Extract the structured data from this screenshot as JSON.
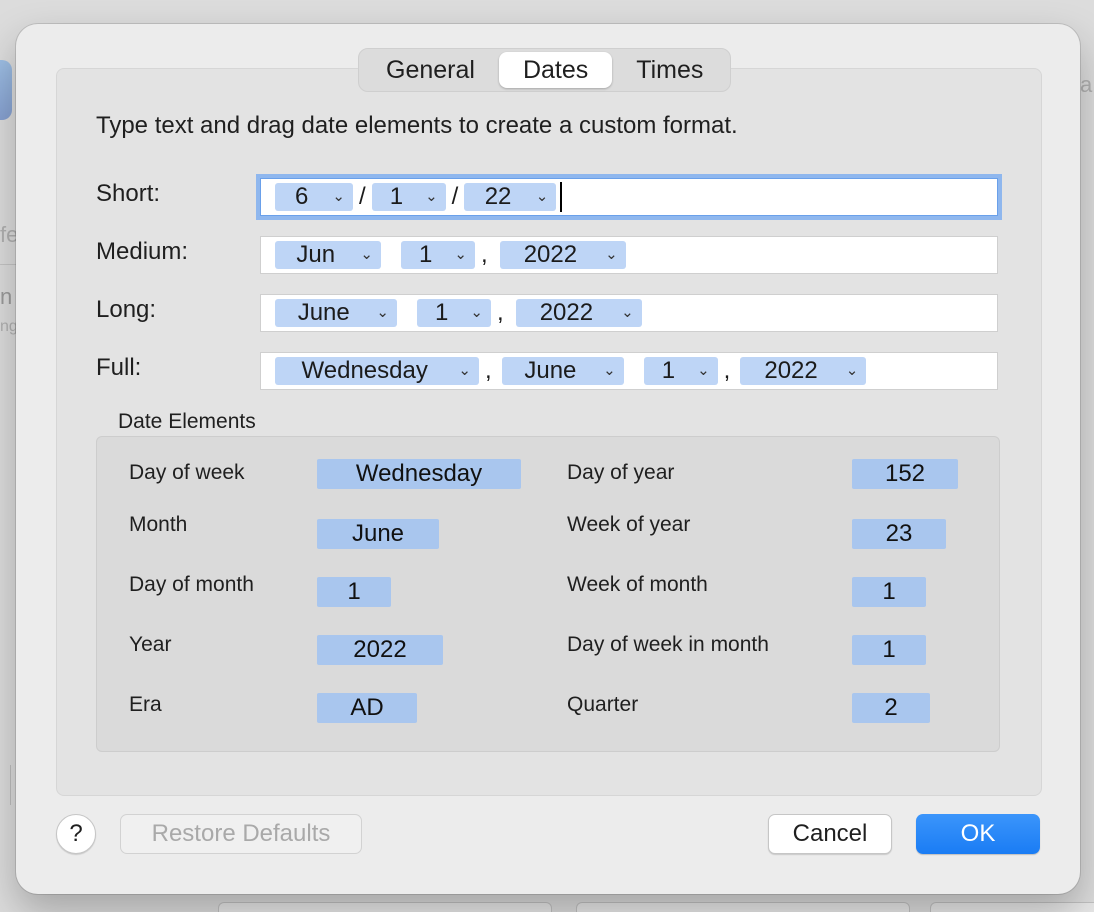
{
  "tabs": [
    {
      "label": "General",
      "selected": false
    },
    {
      "label": "Dates",
      "selected": true
    },
    {
      "label": "Times",
      "selected": false
    }
  ],
  "instructions": "Type text and drag date elements to create a custom format.",
  "formats": {
    "short": {
      "label": "Short:",
      "tokens": [
        "6",
        "1",
        "22"
      ],
      "separators": [
        "/",
        "/"
      ]
    },
    "medium": {
      "label": "Medium:",
      "tokens": [
        "Jun",
        "1",
        "2022"
      ],
      "separators": [
        ",",
        ""
      ]
    },
    "long": {
      "label": "Long:",
      "tokens": [
        "June",
        "1",
        "2022"
      ],
      "separators": [
        ",",
        ""
      ]
    },
    "full": {
      "label": "Full:",
      "tokens": [
        "Wednesday",
        "June",
        "1",
        "2022"
      ],
      "separators": [
        ",",
        ","
      ]
    }
  },
  "date_elements": {
    "title": "Date Elements",
    "left": [
      {
        "label": "Day of week",
        "value": "Wednesday"
      },
      {
        "label": "Month",
        "value": "June"
      },
      {
        "label": "Day of month",
        "value": "1"
      },
      {
        "label": "Year",
        "value": "2022"
      },
      {
        "label": "Era",
        "value": "AD"
      }
    ],
    "right": [
      {
        "label": "Day of year",
        "value": "152"
      },
      {
        "label": "Week of year",
        "value": "23"
      },
      {
        "label": "Week of month",
        "value": "1"
      },
      {
        "label": "Day of week in month",
        "value": "1"
      },
      {
        "label": "Quarter",
        "value": "2"
      }
    ]
  },
  "buttons": {
    "help": "?",
    "restore": "Restore Defaults",
    "cancel": "Cancel",
    "ok": "OK"
  },
  "background": {
    "peek_left_1": "fe",
    "peek_left_2": "n",
    "peek_left_3": "ng",
    "peek_right": "a"
  },
  "colors": {
    "accent": "#1a7cf4",
    "token": "#bed5f6",
    "element_chip": "#a9c6ee"
  }
}
